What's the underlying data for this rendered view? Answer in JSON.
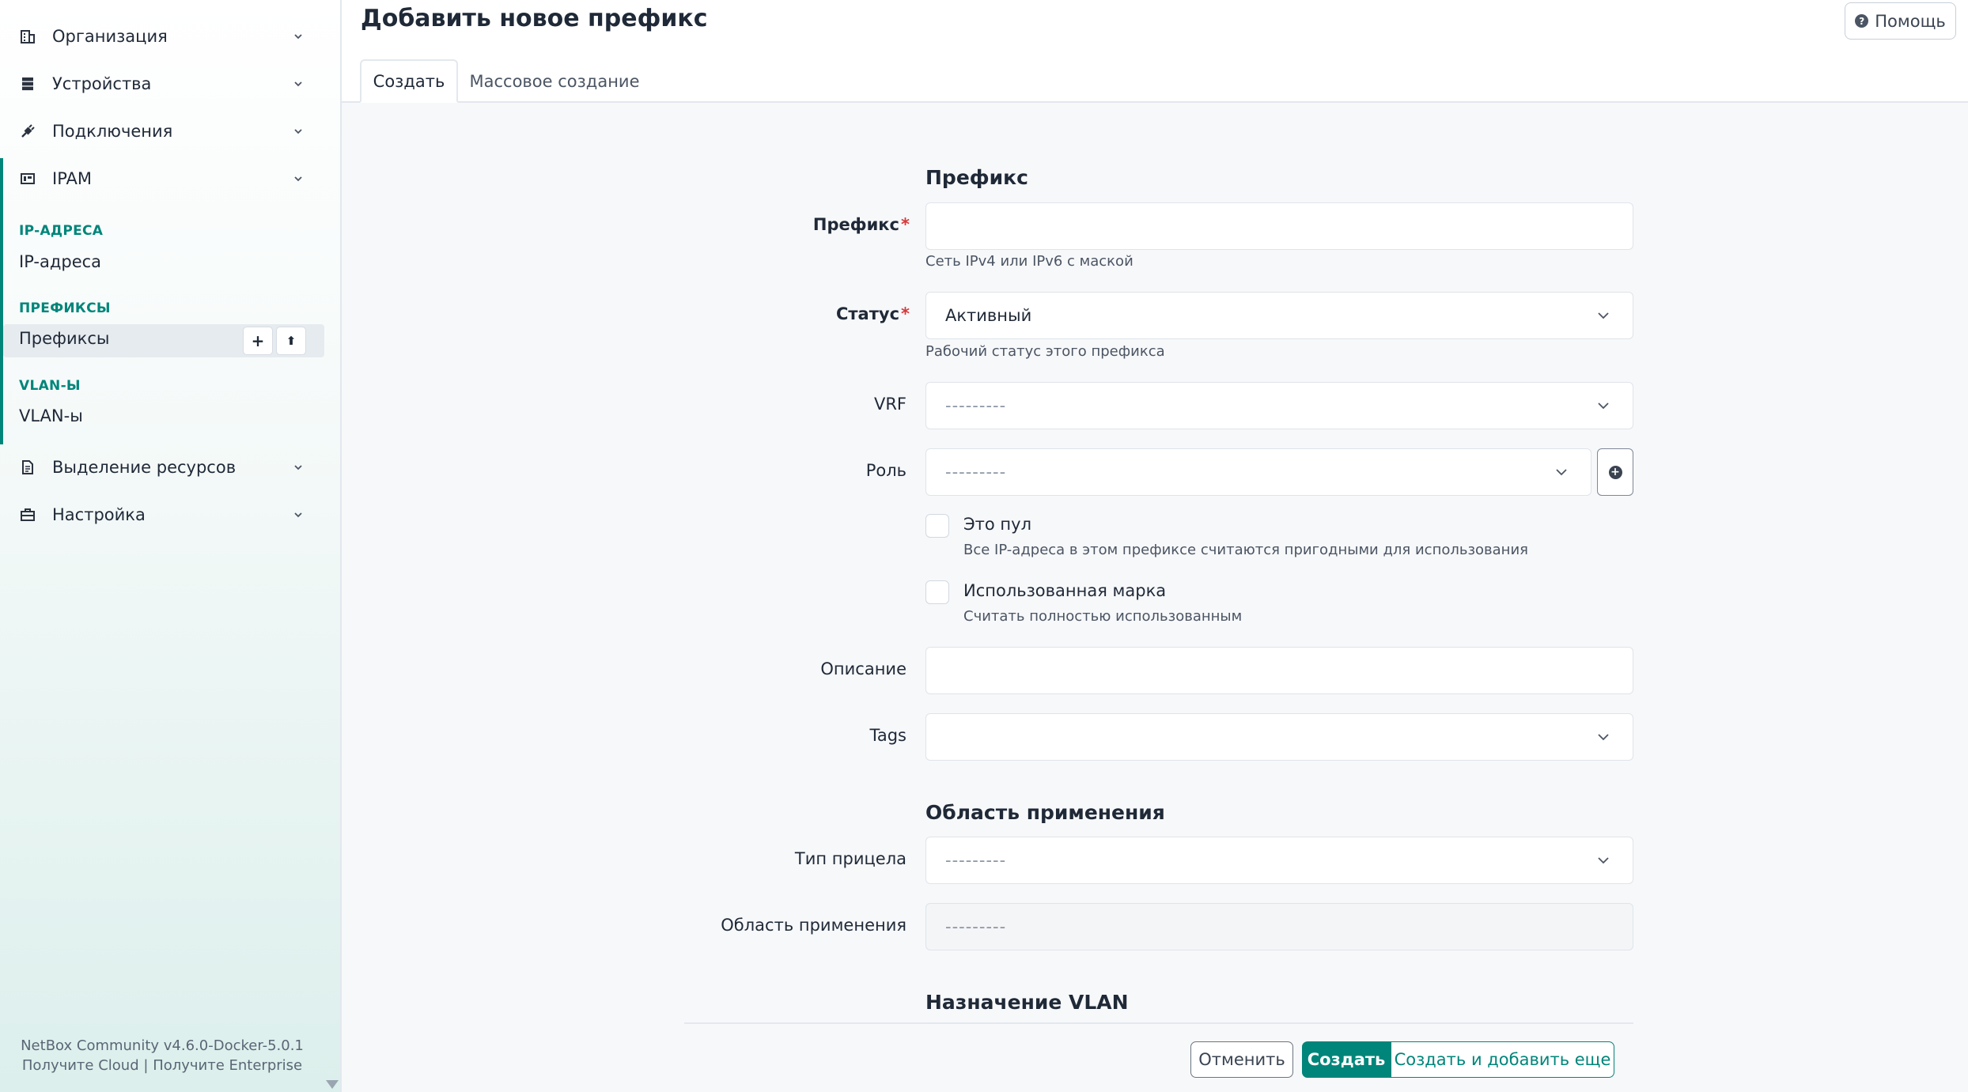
{
  "sidebar": {
    "menus": {
      "organization": "Организация",
      "devices": "Устройства",
      "connections": "Подключения",
      "ipam": "IPAM",
      "provisioning": "Выделение ресурсов",
      "customization": "Настройка"
    },
    "ipam_sections": {
      "ip_addresses_head": "IP-АДРЕСА",
      "ip_addresses_item": "IP-адреса",
      "prefixes_head": "ПРЕФИКСЫ",
      "prefixes_item": "Префиксы",
      "vlans_head": "VLAN-Ы",
      "vlans_item": "VLAN-ы"
    },
    "prefix_add_glyph": "+",
    "prefix_import_glyph": "⬆",
    "footer": {
      "version": "NetBox Community v4.6.0-Docker-5.0.1",
      "cloud_link": "Получите Cloud",
      "separator": "|",
      "enterprise_link": "Получите Enterprise"
    }
  },
  "header": {
    "title": "Добавить новое префикс",
    "help_label": "Помощь"
  },
  "tabs": {
    "create": "Создать",
    "bulk_create": "Массовое создание"
  },
  "form": {
    "section_prefix": "Префикс",
    "prefix": {
      "label": "Префикс",
      "value": "",
      "help": "Сеть IPv4 или IPv6 с маской"
    },
    "status": {
      "label": "Статус",
      "value": "Активный",
      "help": "Рабочий статус этого префикса"
    },
    "vrf": {
      "label": "VRF",
      "value": "---------"
    },
    "role": {
      "label": "Роль",
      "value": "---------"
    },
    "is_pool": {
      "label": "Это пул",
      "help": "Все IP-адреса в этом префиксе считаются пригодными для использования"
    },
    "mark_utilized": {
      "label": "Использованная марка",
      "help": "Считать полностью использованным"
    },
    "description": {
      "label": "Описание",
      "value": ""
    },
    "tags": {
      "label": "Tags",
      "value": ""
    },
    "section_scope": "Область применения",
    "scope_type": {
      "label": "Тип прицела",
      "value": "---------"
    },
    "scope": {
      "label": "Область применения",
      "value": "---------"
    },
    "section_vlan": "Назначение VLAN",
    "required_mark": "*"
  },
  "buttons": {
    "cancel": "Отменить",
    "create": "Создать",
    "create_and_add": "Создать и добавить еще"
  },
  "colors": {
    "accent": "#00857a",
    "required": "#d63939"
  }
}
